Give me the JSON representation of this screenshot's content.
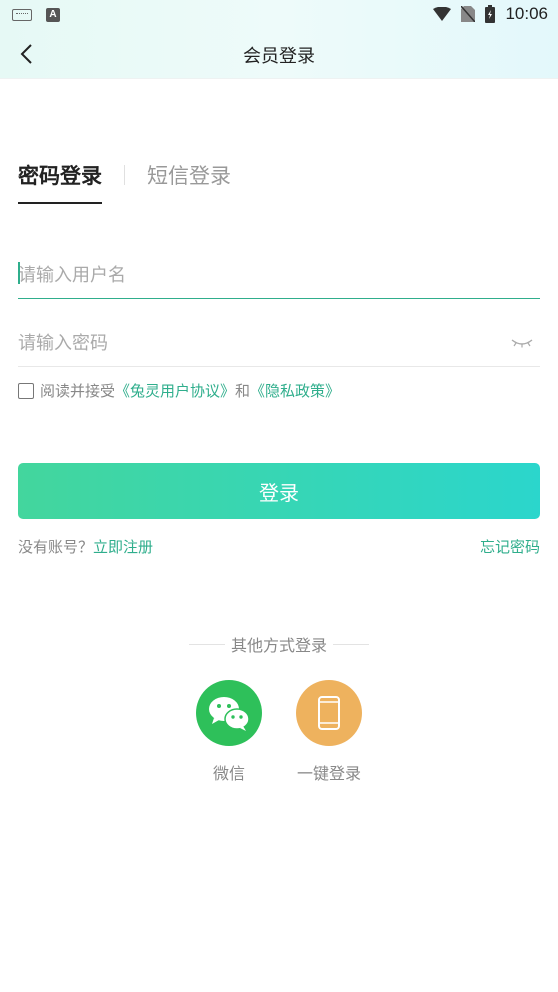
{
  "status_bar": {
    "time": "10:06",
    "a_badge": "A",
    "icons": [
      "keyboard-icon",
      "a-icon",
      "wifi-icon",
      "no-sim-icon",
      "battery-icon"
    ]
  },
  "header": {
    "title": "会员登录"
  },
  "tabs": [
    {
      "label": "密码登录",
      "active": true
    },
    {
      "label": "短信登录",
      "active": false
    }
  ],
  "form": {
    "username_placeholder": "请输入用户名",
    "password_placeholder": "请输入密码"
  },
  "agreement": {
    "prefix": "阅读并接受",
    "terms_link": "《兔灵用户协议》",
    "and": "和",
    "privacy_link": "《隐私政策》"
  },
  "login_button": "登录",
  "register": {
    "prompt": "没有账号？",
    "link": "立即注册"
  },
  "forgot_password": "忘记密码",
  "other_login": {
    "title": "其他方式登录",
    "options": [
      {
        "label": "微信",
        "icon": "wechat-icon",
        "color": "#2ec05a"
      },
      {
        "label": "一键登录",
        "icon": "phone-icon",
        "color": "#eeb25e"
      }
    ]
  },
  "colors": {
    "accent": "#2fae8c",
    "gradient_start": "#43d69d",
    "gradient_end": "#2bd6cc"
  }
}
